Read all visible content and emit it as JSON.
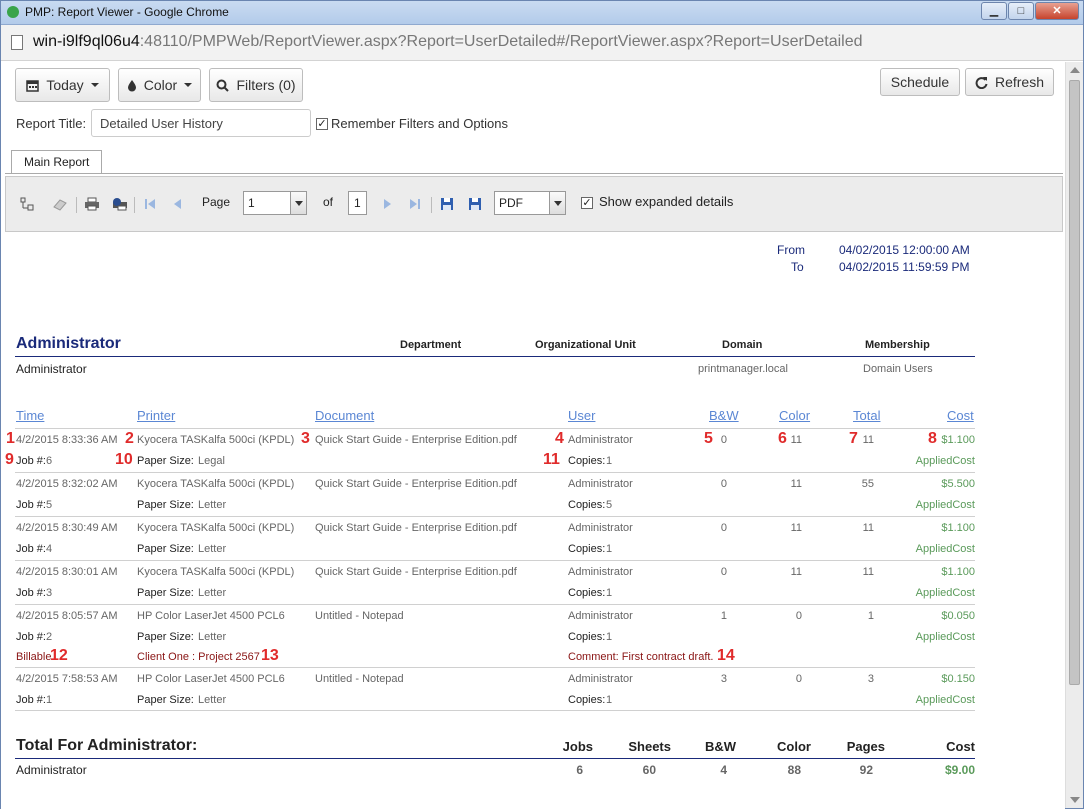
{
  "window": {
    "title": "PMP: Report Viewer - Google Chrome",
    "url_host": "win-i9lf9ql06u4",
    "url_rest": ":48110/PMPWeb/ReportViewer.aspx?Report=UserDetailed#/ReportViewer.aspx?Report=UserDetailed",
    "controls": {
      "minimize": "▁",
      "maximize": "□",
      "close": "✕"
    }
  },
  "toolbar": {
    "today": "Today",
    "color": "Color",
    "filters": "Filters (0)",
    "schedule": "Schedule",
    "refresh": "Refresh"
  },
  "title_row": {
    "label": "Report Title:",
    "value": "Detailed User History",
    "remember_checked": "✓",
    "remember": "Remember Filters and Options"
  },
  "tab": {
    "main": "Main Report"
  },
  "viewer": {
    "page_label": "Page",
    "page_value": "1",
    "of_label": "of",
    "total_pages": "1",
    "format": "PDF",
    "expanded_checked": "✓",
    "expanded": "Show expanded details"
  },
  "report": {
    "from_label": "From",
    "to_label": "To",
    "from": "04/02/2015 12:00:00 AM",
    "to": "04/02/2015 11:59:59 PM",
    "user_title": "Administrator",
    "heads": {
      "department": "Department",
      "org_unit": "Organizational Unit",
      "domain": "Domain",
      "membership": "Membership"
    },
    "user_name": "Administrator",
    "domain": "printmanager.local",
    "membership": "Domain Users",
    "columns": {
      "time": "Time",
      "printer": "Printer",
      "document": "Document",
      "user": "User",
      "bw": "B&W",
      "color": "Color",
      "total": "Total",
      "cost": "Cost"
    },
    "rows": [
      {
        "time": "4/2/2015 8:33:36 AM",
        "printer": "Kyocera TASKalfa 500ci (KPDL)",
        "document": "Quick Start Guide - Enterprise Edition.pdf",
        "user": "Administrator",
        "bw": "0",
        "color": "11",
        "total": "11",
        "cost": "$1.100",
        "job": "Job #:",
        "job_no": "6",
        "paper_label": "Paper Size:",
        "paper": "Legal",
        "copies_label": "Copies:",
        "copies": "1",
        "cost_note": "AppliedCost"
      },
      {
        "time": "4/2/2015 8:32:02 AM",
        "printer": "Kyocera TASKalfa 500ci (KPDL)",
        "document": "Quick Start Guide - Enterprise Edition.pdf",
        "user": "Administrator",
        "bw": "0",
        "color": "11",
        "total": "55",
        "cost": "$5.500",
        "job": "Job #:",
        "job_no": "5",
        "paper_label": "Paper Size:",
        "paper": "Letter",
        "copies_label": "Copies:",
        "copies": "5",
        "cost_note": "AppliedCost"
      },
      {
        "time": "4/2/2015 8:30:49 AM",
        "printer": "Kyocera TASKalfa 500ci (KPDL)",
        "document": "Quick Start Guide - Enterprise Edition.pdf",
        "user": "Administrator",
        "bw": "0",
        "color": "11",
        "total": "11",
        "cost": "$1.100",
        "job": "Job #:",
        "job_no": "4",
        "paper_label": "Paper Size:",
        "paper": "Letter",
        "copies_label": "Copies:",
        "copies": "1",
        "cost_note": "AppliedCost"
      },
      {
        "time": "4/2/2015 8:30:01 AM",
        "printer": "Kyocera TASKalfa 500ci (KPDL)",
        "document": "Quick Start Guide - Enterprise Edition.pdf",
        "user": "Administrator",
        "bw": "0",
        "color": "11",
        "total": "11",
        "cost": "$1.100",
        "job": "Job #:",
        "job_no": "3",
        "paper_label": "Paper Size:",
        "paper": "Letter",
        "copies_label": "Copies:",
        "copies": "1",
        "cost_note": "AppliedCost"
      },
      {
        "time": "4/2/2015 8:05:57 AM",
        "printer": "HP Color LaserJet 4500 PCL6",
        "document": "Untitled - Notepad",
        "user": "Administrator",
        "bw": "1",
        "color": "0",
        "total": "1",
        "cost": "$0.050",
        "job": "Job #:",
        "job_no": "2",
        "paper_label": "Paper Size:",
        "paper": "Letter",
        "copies_label": "Copies:",
        "copies": "1",
        "cost_note": "AppliedCost"
      },
      {
        "time": "4/2/2015 7:58:53 AM",
        "printer": "HP Color LaserJet 4500 PCL6",
        "document": "Untitled - Notepad",
        "user": "Administrator",
        "bw": "3",
        "color": "0",
        "total": "3",
        "cost": "$0.150",
        "job": "Job #:",
        "job_no": "1",
        "paper_label": "Paper Size:",
        "paper": "Letter",
        "copies_label": "Copies:",
        "copies": "1",
        "cost_note": "AppliedCost"
      }
    ],
    "extra": {
      "billable": "Billable",
      "client": "Client One : Project 2567",
      "comment": "Comment: First contract draft."
    },
    "totals": {
      "label": "Total For Administrator:",
      "heads": {
        "jobs": "Jobs",
        "sheets": "Sheets",
        "bw": "B&W",
        "color": "Color",
        "pages": "Pages",
        "cost": "Cost"
      },
      "name": "Administrator",
      "jobs": "6",
      "sheets": "60",
      "bw": "4",
      "color": "88",
      "pages": "92",
      "cost": "$9.00"
    }
  },
  "markers": [
    "1",
    "2",
    "3",
    "4",
    "5",
    "6",
    "7",
    "8",
    "9",
    "10",
    "11",
    "12",
    "13",
    "14"
  ],
  "colors": {
    "navy": "#1a2a7a",
    "link": "#5b87d4",
    "green": "#5a9a5a",
    "marker": "#e02b2b",
    "maroon": "#8a1515"
  }
}
